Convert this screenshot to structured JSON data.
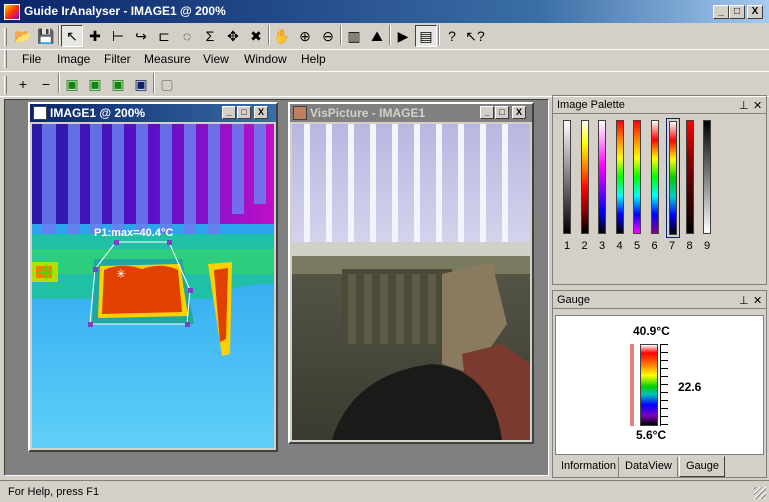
{
  "app": {
    "title": "Guide IrAnalyser - IMAGE1 @ 200%"
  },
  "window_controls": {
    "minimize": "_",
    "maximize": "□",
    "close": "X"
  },
  "toolbar1": [
    {
      "name": "open-icon",
      "glyph": "📂"
    },
    {
      "name": "save-icon",
      "glyph": "💾"
    },
    {
      "name": "pointer-icon",
      "glyph": "↖"
    },
    {
      "name": "spot-icon",
      "glyph": "✚"
    },
    {
      "name": "line-icon",
      "glyph": "⊢"
    },
    {
      "name": "polyline-icon",
      "glyph": "↪"
    },
    {
      "name": "rectangle-icon",
      "glyph": "⊏"
    },
    {
      "name": "ellipse-icon",
      "glyph": "◌"
    },
    {
      "name": "sum-icon",
      "glyph": "Σ"
    },
    {
      "name": "move-icon",
      "glyph": "✥"
    },
    {
      "name": "delete-icon",
      "glyph": "✖"
    },
    {
      "name": "hand-icon",
      "glyph": "✋"
    },
    {
      "name": "zoom-in-icon",
      "glyph": "⊕"
    },
    {
      "name": "zoom-out-icon",
      "glyph": "⊖"
    },
    {
      "name": "histogram-icon",
      "glyph": "▥"
    },
    {
      "name": "profile-icon",
      "glyph": "⛰"
    },
    {
      "name": "play-icon",
      "glyph": "▶"
    },
    {
      "name": "palette-icon",
      "glyph": "▤"
    },
    {
      "name": "help-icon",
      "glyph": "?"
    },
    {
      "name": "context-help-icon",
      "glyph": "↖?"
    }
  ],
  "menu": [
    "File",
    "Image",
    "Filter",
    "Measure",
    "View",
    "Window",
    "Help"
  ],
  "toolbar2": [
    {
      "name": "plus-icon",
      "glyph": "+"
    },
    {
      "name": "minus-icon",
      "glyph": "−"
    },
    {
      "name": "layer1-icon",
      "glyph": "▣"
    },
    {
      "name": "layer2-icon",
      "glyph": "▣"
    },
    {
      "name": "layer3-icon",
      "glyph": "▣"
    },
    {
      "name": "layer4-icon",
      "glyph": "▣"
    },
    {
      "name": "layer5-icon",
      "glyph": "▢"
    }
  ],
  "thermal_window": {
    "title": "IMAGE1 @ 200%",
    "label": "P1:max=40.4°C"
  },
  "visual_window": {
    "title": "VisPicture - IMAGE1"
  },
  "palette_panel": {
    "title": "Image Palette",
    "selected": 7,
    "numbers": [
      "1",
      "2",
      "3",
      "4",
      "5",
      "6",
      "7",
      "8",
      "9"
    ],
    "pin": "⊥",
    "close": "✕"
  },
  "gauge_panel": {
    "title": "Gauge",
    "max": "40.9°C",
    "min": "5.6°C",
    "mid": "22.6",
    "pin": "⊥",
    "close": "✕"
  },
  "tabs": [
    "Information",
    "DataView",
    "Gauge"
  ],
  "active_tab": "Gauge",
  "status": {
    "text": "For Help, press F1"
  },
  "colors": {
    "titlebar": "#0a246a",
    "inactive_title": "#808080",
    "mdi": "#808080"
  }
}
